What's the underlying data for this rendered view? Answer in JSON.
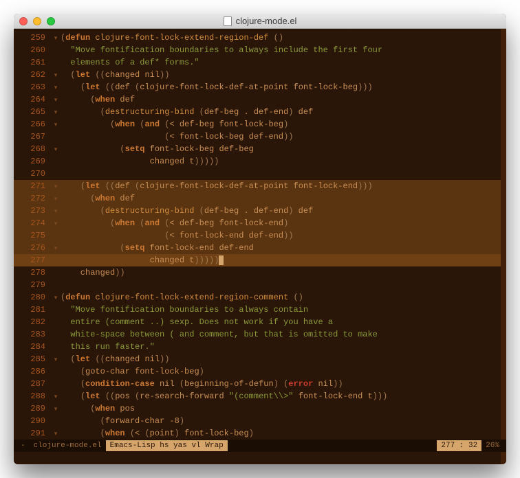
{
  "window": {
    "title": "clojure-mode.el"
  },
  "lines": [
    {
      "num": "259",
      "fold": "▾",
      "hl": false,
      "tokens": [
        [
          "paren",
          "("
        ],
        [
          "kw",
          "defun"
        ],
        [
          "plain",
          " "
        ],
        [
          "fn",
          "clojure-font-lock-extend-region-def"
        ],
        [
          "plain",
          " "
        ],
        [
          "paren",
          "()"
        ]
      ]
    },
    {
      "num": "260",
      "fold": "",
      "hl": false,
      "tokens": [
        [
          "str",
          "  \"Move fontification boundaries to always include the first four"
        ]
      ]
    },
    {
      "num": "261",
      "fold": "",
      "hl": false,
      "tokens": [
        [
          "str",
          "  elements of a def* forms.\""
        ]
      ]
    },
    {
      "num": "262",
      "fold": "▾",
      "hl": false,
      "tokens": [
        [
          "plain",
          "  "
        ],
        [
          "paren",
          "("
        ],
        [
          "kw",
          "let"
        ],
        [
          "plain",
          " "
        ],
        [
          "paren",
          "(("
        ],
        [
          "plain",
          "changed nil"
        ],
        [
          "paren",
          "))"
        ]
      ]
    },
    {
      "num": "263",
      "fold": "▾",
      "hl": false,
      "tokens": [
        [
          "plain",
          "    "
        ],
        [
          "paren",
          "("
        ],
        [
          "kw",
          "let"
        ],
        [
          "plain",
          " "
        ],
        [
          "paren",
          "(("
        ],
        [
          "plain",
          "def "
        ],
        [
          "paren",
          "("
        ],
        [
          "plain",
          "clojure-font-lock-def-at-point font-lock-beg"
        ],
        [
          "paren",
          ")))"
        ]
      ]
    },
    {
      "num": "264",
      "fold": "▾",
      "hl": false,
      "tokens": [
        [
          "plain",
          "      "
        ],
        [
          "paren",
          "("
        ],
        [
          "kw",
          "when"
        ],
        [
          "plain",
          " def"
        ]
      ]
    },
    {
      "num": "265",
      "fold": "▾",
      "hl": false,
      "tokens": [
        [
          "plain",
          "        "
        ],
        [
          "paren",
          "("
        ],
        [
          "fn",
          "destructuring-bind"
        ],
        [
          "plain",
          " "
        ],
        [
          "paren",
          "("
        ],
        [
          "plain",
          "def-beg . def-end"
        ],
        [
          "paren",
          ")"
        ],
        [
          "plain",
          " def"
        ]
      ]
    },
    {
      "num": "266",
      "fold": "▾",
      "hl": false,
      "tokens": [
        [
          "plain",
          "          "
        ],
        [
          "paren",
          "("
        ],
        [
          "kw",
          "when"
        ],
        [
          "plain",
          " "
        ],
        [
          "paren",
          "("
        ],
        [
          "kw",
          "and"
        ],
        [
          "plain",
          " "
        ],
        [
          "paren",
          "("
        ],
        [
          "plain",
          "< def-beg font-lock-beg"
        ],
        [
          "paren",
          ")"
        ]
      ]
    },
    {
      "num": "267",
      "fold": "",
      "hl": false,
      "tokens": [
        [
          "plain",
          "                     "
        ],
        [
          "paren",
          "("
        ],
        [
          "plain",
          "< font-lock-beg def-end"
        ],
        [
          "paren",
          "))"
        ]
      ]
    },
    {
      "num": "268",
      "fold": "▾",
      "hl": false,
      "tokens": [
        [
          "plain",
          "            "
        ],
        [
          "paren",
          "("
        ],
        [
          "kw",
          "setq"
        ],
        [
          "plain",
          " font-lock-beg def-beg"
        ]
      ]
    },
    {
      "num": "269",
      "fold": "",
      "hl": false,
      "tokens": [
        [
          "plain",
          "                  changed t"
        ],
        [
          "paren",
          ")))))"
        ]
      ]
    },
    {
      "num": "270",
      "fold": "",
      "hl": false,
      "tokens": []
    },
    {
      "num": "271",
      "fold": "▾",
      "hl": true,
      "tokens": [
        [
          "plain",
          "    "
        ],
        [
          "paren",
          "("
        ],
        [
          "kw",
          "let"
        ],
        [
          "plain",
          " "
        ],
        [
          "paren",
          "(("
        ],
        [
          "plain",
          "def "
        ],
        [
          "paren",
          "("
        ],
        [
          "plain",
          "clojure-font-lock-def-at-point font-lock-end"
        ],
        [
          "paren",
          ")))"
        ]
      ]
    },
    {
      "num": "272",
      "fold": "▾",
      "hl": true,
      "tokens": [
        [
          "plain",
          "      "
        ],
        [
          "paren",
          "("
        ],
        [
          "kw",
          "when"
        ],
        [
          "plain",
          " def"
        ]
      ]
    },
    {
      "num": "273",
      "fold": "▾",
      "hl": true,
      "tokens": [
        [
          "plain",
          "        "
        ],
        [
          "paren",
          "("
        ],
        [
          "fn",
          "destructuring-bind"
        ],
        [
          "plain",
          " "
        ],
        [
          "paren",
          "("
        ],
        [
          "plain",
          "def-beg . def-end"
        ],
        [
          "paren",
          ")"
        ],
        [
          "plain",
          " def"
        ]
      ]
    },
    {
      "num": "274",
      "fold": "▾",
      "hl": true,
      "tokens": [
        [
          "plain",
          "          "
        ],
        [
          "paren",
          "("
        ],
        [
          "kw",
          "when"
        ],
        [
          "plain",
          " "
        ],
        [
          "paren",
          "("
        ],
        [
          "kw",
          "and"
        ],
        [
          "plain",
          " "
        ],
        [
          "paren",
          "("
        ],
        [
          "plain",
          "< def-beg font-lock-end"
        ],
        [
          "paren",
          ")"
        ]
      ]
    },
    {
      "num": "275",
      "fold": "",
      "hl": true,
      "tokens": [
        [
          "plain",
          "                     "
        ],
        [
          "paren",
          "("
        ],
        [
          "plain",
          "< font-lock-end def-end"
        ],
        [
          "paren",
          "))"
        ]
      ]
    },
    {
      "num": "276",
      "fold": "▾",
      "hl": true,
      "tokens": [
        [
          "plain",
          "            "
        ],
        [
          "paren",
          "("
        ],
        [
          "kw",
          "setq"
        ],
        [
          "plain",
          " font-lock-end def-end"
        ]
      ]
    },
    {
      "num": "277",
      "fold": "",
      "hl": true,
      "cursor": true,
      "tokens": [
        [
          "plain",
          "                  changed t"
        ],
        [
          "paren",
          ")))))"
        ]
      ]
    },
    {
      "num": "278",
      "fold": "",
      "hl": false,
      "tokens": [
        [
          "plain",
          "    changed"
        ],
        [
          "paren",
          "))"
        ]
      ]
    },
    {
      "num": "279",
      "fold": "",
      "hl": false,
      "tokens": []
    },
    {
      "num": "280",
      "fold": "▾",
      "hl": false,
      "tokens": [
        [
          "paren",
          "("
        ],
        [
          "kw",
          "defun"
        ],
        [
          "plain",
          " "
        ],
        [
          "fn",
          "clojure-font-lock-extend-region-comment"
        ],
        [
          "plain",
          " "
        ],
        [
          "paren",
          "()"
        ]
      ]
    },
    {
      "num": "281",
      "fold": "",
      "hl": false,
      "tokens": [
        [
          "str",
          "  \"Move fontification boundaries to always contain"
        ]
      ]
    },
    {
      "num": "282",
      "fold": "",
      "hl": false,
      "tokens": [
        [
          "str",
          "  entire (comment ..) sexp. Does not work if you have a"
        ]
      ]
    },
    {
      "num": "283",
      "fold": "",
      "hl": false,
      "tokens": [
        [
          "str",
          "  white-space between ( and comment, but that is omitted to make"
        ]
      ]
    },
    {
      "num": "284",
      "fold": "",
      "hl": false,
      "tokens": [
        [
          "str",
          "  this run faster.\""
        ]
      ]
    },
    {
      "num": "285",
      "fold": "▾",
      "hl": false,
      "tokens": [
        [
          "plain",
          "  "
        ],
        [
          "paren",
          "("
        ],
        [
          "kw",
          "let"
        ],
        [
          "plain",
          " "
        ],
        [
          "paren",
          "(("
        ],
        [
          "plain",
          "changed nil"
        ],
        [
          "paren",
          "))"
        ]
      ]
    },
    {
      "num": "286",
      "fold": "",
      "hl": false,
      "tokens": [
        [
          "plain",
          "    "
        ],
        [
          "paren",
          "("
        ],
        [
          "plain",
          "goto-char font-lock-beg"
        ],
        [
          "paren",
          ")"
        ]
      ]
    },
    {
      "num": "287",
      "fold": "",
      "hl": false,
      "tokens": [
        [
          "plain",
          "    "
        ],
        [
          "paren",
          "("
        ],
        [
          "kw",
          "condition-case"
        ],
        [
          "plain",
          " nil "
        ],
        [
          "paren",
          "("
        ],
        [
          "plain",
          "beginning-of-defun"
        ],
        [
          "paren",
          ")"
        ],
        [
          "plain",
          " "
        ],
        [
          "paren",
          "("
        ],
        [
          "err",
          "error"
        ],
        [
          "plain",
          " nil"
        ],
        [
          "paren",
          "))"
        ]
      ]
    },
    {
      "num": "288",
      "fold": "▾",
      "hl": false,
      "tokens": [
        [
          "plain",
          "    "
        ],
        [
          "paren",
          "("
        ],
        [
          "kw",
          "let"
        ],
        [
          "plain",
          " "
        ],
        [
          "paren",
          "(("
        ],
        [
          "plain",
          "pos "
        ],
        [
          "paren",
          "("
        ],
        [
          "plain",
          "re-search-forward "
        ],
        [
          "str",
          "\"(comment\\\\>\""
        ],
        [
          "plain",
          " font-lock-end t"
        ],
        [
          "paren",
          ")))"
        ]
      ]
    },
    {
      "num": "289",
      "fold": "▾",
      "hl": false,
      "tokens": [
        [
          "plain",
          "      "
        ],
        [
          "paren",
          "("
        ],
        [
          "kw",
          "when"
        ],
        [
          "plain",
          " pos"
        ]
      ]
    },
    {
      "num": "290",
      "fold": "",
      "hl": false,
      "tokens": [
        [
          "plain",
          "        "
        ],
        [
          "paren",
          "("
        ],
        [
          "plain",
          "forward-char -8"
        ],
        [
          "paren",
          ")"
        ]
      ]
    },
    {
      "num": "291",
      "fold": "▾",
      "hl": false,
      "tokens": [
        [
          "plain",
          "        "
        ],
        [
          "paren",
          "("
        ],
        [
          "kw",
          "when"
        ],
        [
          "plain",
          " "
        ],
        [
          "paren",
          "("
        ],
        [
          "plain",
          "< "
        ],
        [
          "paren",
          "("
        ],
        [
          "plain",
          "point"
        ],
        [
          "paren",
          ")"
        ],
        [
          "plain",
          " font-lock-beg"
        ],
        [
          "paren",
          ")"
        ]
      ]
    }
  ],
  "modeline": {
    "modified": "-",
    "buffer": "clojure-mode.el",
    "major": "Emacs-Lisp hs yas vl Wrap",
    "pos": "277 : 32",
    "pct": "26%"
  }
}
